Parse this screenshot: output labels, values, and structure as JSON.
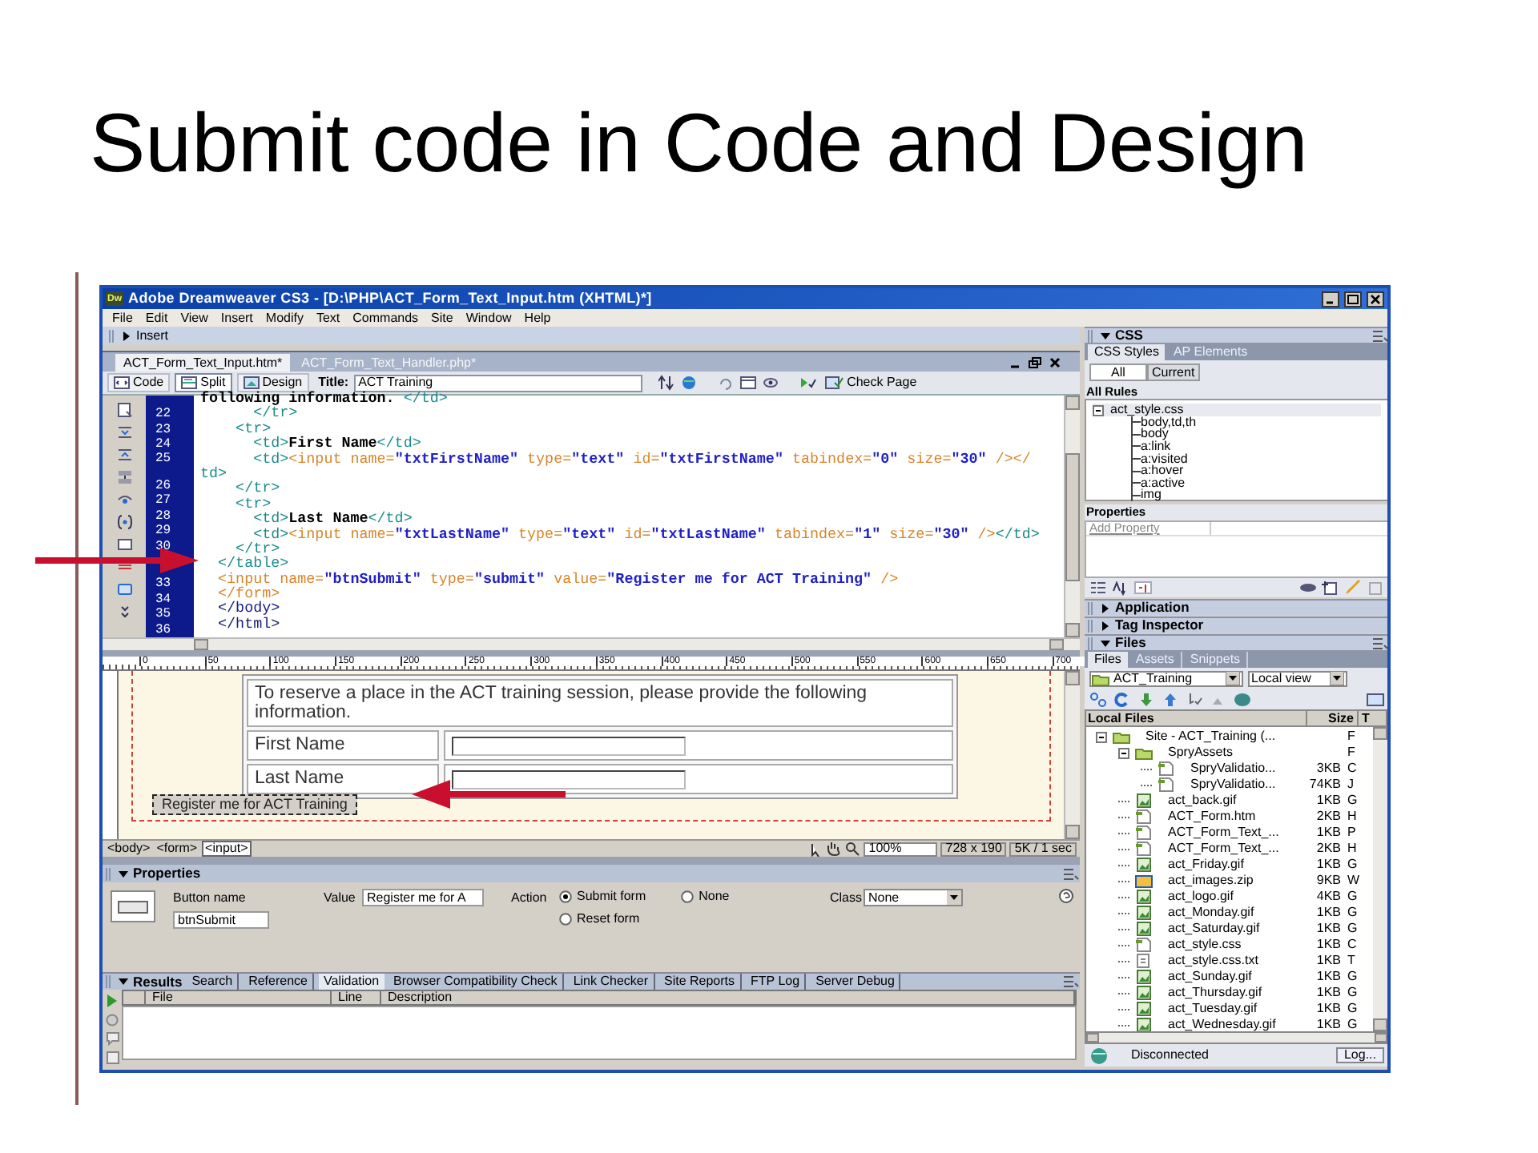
{
  "slide": {
    "title": "Submit code in Code and Design"
  },
  "window": {
    "logo": "Dw",
    "title": "Adobe Dreamweaver CS3 - [D:\\PHP\\ACT_Form_Text_Input.htm (XHTML)*]"
  },
  "menu": [
    "File",
    "Edit",
    "View",
    "Insert",
    "Modify",
    "Text",
    "Commands",
    "Site",
    "Window",
    "Help"
  ],
  "insert_bar": {
    "label": "Insert",
    "expanded": false
  },
  "document_tabs": [
    {
      "label": "ACT_Form_Text_Input.htm*",
      "selected": true
    },
    {
      "label": "ACT_Form_Text_Handler.php*",
      "selected": false
    }
  ],
  "view_buttons": [
    {
      "label": "Code",
      "selected": false
    },
    {
      "label": "Split",
      "selected": true
    },
    {
      "label": "Design",
      "selected": false
    }
  ],
  "title_field": {
    "label": "Title:",
    "value": "ACT Training"
  },
  "check_page": "Check Page",
  "code_lines": [
    {
      "segments": [
        {
          "kind": "text",
          "text": "following information. "
        },
        {
          "kind": "tag",
          "text": "</td>"
        }
      ]
    },
    {
      "number": "22",
      "segments": [
        {
          "kind": "tag",
          "text": "      </tr>"
        }
      ]
    },
    {
      "number": "23",
      "segments": [
        {
          "kind": "tag",
          "text": "    <tr>"
        }
      ]
    },
    {
      "number": "24",
      "segments": [
        {
          "kind": "tag",
          "text": "      <td>"
        },
        {
          "kind": "text",
          "text": "First Name"
        },
        {
          "kind": "tag",
          "text": "</td>"
        }
      ]
    },
    {
      "number": "25",
      "segments": [
        {
          "kind": "tag",
          "text": "      <td>"
        },
        {
          "kind": "form",
          "text": "<input name="
        },
        {
          "kind": "value",
          "text": "\"txtFirstName\""
        },
        {
          "kind": "form",
          "text": " type="
        },
        {
          "kind": "value",
          "text": "\"text\""
        },
        {
          "kind": "form",
          "text": " id="
        },
        {
          "kind": "value",
          "text": "\"txtFirstName\""
        },
        {
          "kind": "form",
          "text": " tabindex="
        },
        {
          "kind": "value",
          "text": "\"0\""
        },
        {
          "kind": "form",
          "text": " size="
        },
        {
          "kind": "value",
          "text": "\"30\""
        },
        {
          "kind": "form",
          "text": " /></"
        }
      ]
    },
    {
      "segments": [
        {
          "kind": "tag",
          "text": "td>"
        }
      ]
    },
    {
      "number": "26",
      "segments": [
        {
          "kind": "tag",
          "text": "    </tr>"
        }
      ]
    },
    {
      "number": "27",
      "segments": [
        {
          "kind": "tag",
          "text": "    <tr>"
        }
      ]
    },
    {
      "number": "28",
      "segments": [
        {
          "kind": "tag",
          "text": "      <td>"
        },
        {
          "kind": "text",
          "text": "Last Name"
        },
        {
          "kind": "tag",
          "text": "</td>"
        }
      ]
    },
    {
      "number": "29",
      "segments": [
        {
          "kind": "tag",
          "text": "      <td>"
        },
        {
          "kind": "form",
          "text": "<input name="
        },
        {
          "kind": "value",
          "text": "\"txtLastName\""
        },
        {
          "kind": "form",
          "text": " type="
        },
        {
          "kind": "value",
          "text": "\"text\""
        },
        {
          "kind": "form",
          "text": " id="
        },
        {
          "kind": "value",
          "text": "\"txtLastName\""
        },
        {
          "kind": "form",
          "text": " tabindex="
        },
        {
          "kind": "value",
          "text": "\"1\""
        },
        {
          "kind": "form",
          "text": " size="
        },
        {
          "kind": "value",
          "text": "\"30\""
        },
        {
          "kind": "form",
          "text": " />"
        },
        {
          "kind": "tag",
          "text": "</td>"
        }
      ]
    },
    {
      "number": "30",
      "segments": [
        {
          "kind": "tag",
          "text": "    </tr>"
        }
      ]
    },
    {
      "segments": [
        {
          "kind": "tag",
          "text": "  </table>"
        }
      ]
    },
    {
      "segments": [
        {
          "kind": "form",
          "text": "  <input name="
        },
        {
          "kind": "value",
          "text": "\"btnSubmit\""
        },
        {
          "kind": "form",
          "text": " type="
        },
        {
          "kind": "value",
          "text": "\"submit\""
        },
        {
          "kind": "form",
          "text": " value="
        },
        {
          "kind": "value",
          "text": "\"Register me for ACT Training\""
        },
        {
          "kind": "form",
          "text": " />"
        }
      ]
    },
    {
      "number": "33",
      "segments": [
        {
          "kind": "form",
          "text": "  </form>"
        }
      ]
    },
    {
      "number": "34",
      "segments": [
        {
          "kind": "page",
          "text": "  </body>"
        }
      ]
    },
    {
      "number": "35",
      "segments": [
        {
          "kind": "page",
          "text": "  </html>"
        }
      ]
    },
    {
      "number": "36"
    }
  ],
  "ruler_labels": [
    "0",
    "50",
    "100",
    "150",
    "200",
    "250",
    "300",
    "350",
    "400",
    "450",
    "500",
    "550",
    "600",
    "650",
    "700"
  ],
  "design": {
    "intro": "To reserve a place in the ACT training session, please provide the following information.",
    "fields": [
      {
        "label": "First Name"
      },
      {
        "label": "Last Name"
      }
    ],
    "submit": "Register me for ACT Training"
  },
  "tag_selector": [
    {
      "label": "<body>",
      "selected": false
    },
    {
      "label": "<form>",
      "selected": false
    },
    {
      "label": "<input>",
      "selected": true
    }
  ],
  "status": {
    "zoom": "100%",
    "window_size": "728 x 190",
    "download": "5K / 1 sec"
  },
  "properties": {
    "title": "Properties",
    "expanded": true,
    "button_name_label": "Button name",
    "button_name": "btnSubmit",
    "value_label": "Value",
    "value": "Register me for A",
    "action_label": "Action",
    "actions": [
      {
        "label": "Submit form",
        "selected": true
      },
      {
        "label": "None",
        "selected": false
      },
      {
        "label": "Reset form",
        "selected": false
      }
    ],
    "class_label": "Class",
    "class": "None"
  },
  "results": {
    "title": "Results",
    "expanded": true,
    "tabs": [
      {
        "label": "Search",
        "selected": false
      },
      {
        "label": "Reference",
        "selected": false
      },
      {
        "label": "Validation",
        "selected": true
      },
      {
        "label": "Browser Compatibility Check",
        "selected": false
      },
      {
        "label": "Link Checker",
        "selected": false
      },
      {
        "label": "Site Reports",
        "selected": false
      },
      {
        "label": "FTP Log",
        "selected": false
      },
      {
        "label": "Server Debug",
        "selected": false
      }
    ],
    "columns": [
      "File",
      "Line",
      "Description"
    ]
  },
  "css_panel": {
    "title": "CSS",
    "expanded": true,
    "tabs": [
      {
        "label": "CSS Styles",
        "selected": true
      },
      {
        "label": "AP Elements",
        "selected": false
      }
    ],
    "modes": [
      {
        "label": "All",
        "selected": true
      },
      {
        "label": "Current",
        "selected": false
      }
    ],
    "rules_title": "All Rules",
    "rules": [
      {
        "label": "act_style.css",
        "expanded": true,
        "children": [
          {
            "label": "body,td,th"
          },
          {
            "label": "body"
          },
          {
            "label": "a:link"
          },
          {
            "label": "a:visited"
          },
          {
            "label": "a:hover"
          },
          {
            "label": "a:active"
          },
          {
            "label": "img"
          }
        ]
      }
    ],
    "properties_title": "Properties",
    "add_property": "Add Property"
  },
  "collapsed_panels": [
    {
      "title": "Application",
      "expanded": false
    },
    {
      "title": "Tag Inspector",
      "expanded": false
    }
  ],
  "files_panel": {
    "title": "Files",
    "expanded": true,
    "tabs": [
      {
        "label": "Files",
        "selected": true
      },
      {
        "label": "Assets",
        "selected": false
      },
      {
        "label": "Snippets",
        "selected": false
      }
    ],
    "site": "ACT_Training",
    "view": "Local view",
    "columns": [
      "Local Files",
      "Size",
      "T"
    ],
    "tree": [
      {
        "kind": "site",
        "name": "Site - ACT_Training (...",
        "type": "F",
        "expanded": true,
        "children": [
          {
            "kind": "folder",
            "name": "SpryAssets",
            "type": "F",
            "expanded": true,
            "children": [
              {
                "kind": "page",
                "name": "SpryValidatio...",
                "size": "3KB",
                "type": "C"
              },
              {
                "kind": "page",
                "name": "SpryValidatio...",
                "size": "74KB",
                "type": "J"
              }
            ]
          },
          {
            "kind": "image",
            "name": "act_back.gif",
            "size": "1KB",
            "type": "G"
          },
          {
            "kind": "page",
            "name": "ACT_Form.htm",
            "size": "2KB",
            "type": "H"
          },
          {
            "kind": "page",
            "name": "ACT_Form_Text_...",
            "size": "1KB",
            "type": "P"
          },
          {
            "kind": "page",
            "name": "ACT_Form_Text_...",
            "size": "2KB",
            "type": "H"
          },
          {
            "kind": "image",
            "name": "act_Friday.gif",
            "size": "1KB",
            "type": "G"
          },
          {
            "kind": "zip",
            "name": "act_images.zip",
            "size": "9KB",
            "type": "W"
          },
          {
            "kind": "image",
            "name": "act_logo.gif",
            "size": "4KB",
            "type": "G"
          },
          {
            "kind": "image",
            "name": "act_Monday.gif",
            "size": "1KB",
            "type": "G"
          },
          {
            "kind": "image",
            "name": "act_Saturday.gif",
            "size": "1KB",
            "type": "G"
          },
          {
            "kind": "page",
            "name": "act_style.css",
            "size": "1KB",
            "type": "C"
          },
          {
            "kind": "text",
            "name": "act_style.css.txt",
            "size": "1KB",
            "type": "T"
          },
          {
            "kind": "image",
            "name": "act_Sunday.gif",
            "size": "1KB",
            "type": "G"
          },
          {
            "kind": "image",
            "name": "act_Thursday.gif",
            "size": "1KB",
            "type": "G"
          },
          {
            "kind": "image",
            "name": "act_Tuesday.gif",
            "size": "1KB",
            "type": "G"
          },
          {
            "kind": "image",
            "name": "act_Wednesday.gif",
            "size": "1KB",
            "type": "G"
          }
        ]
      }
    ],
    "status": "Disconnected",
    "log_button": "Log..."
  }
}
